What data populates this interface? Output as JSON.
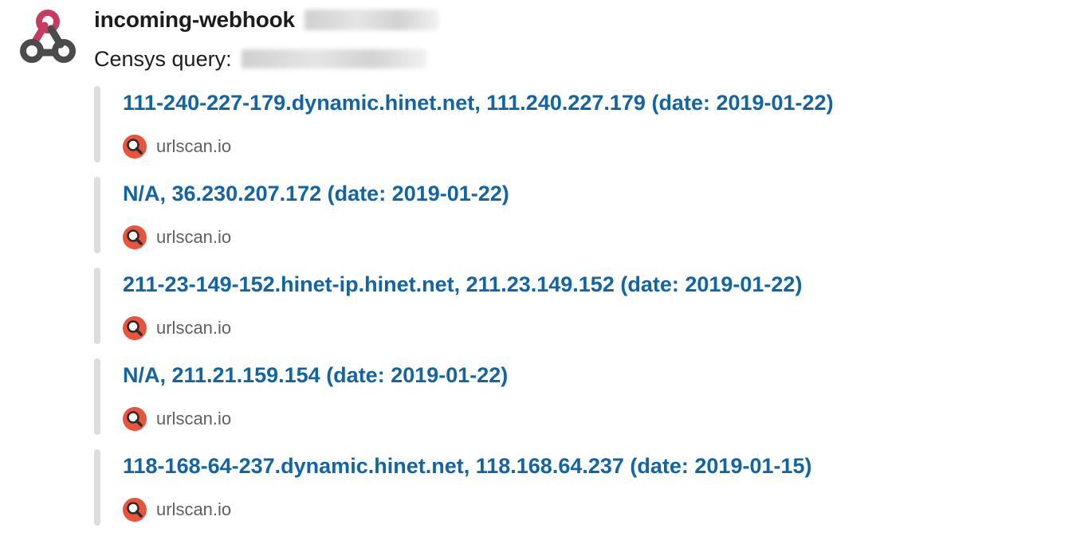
{
  "message": {
    "app_name": "incoming-webhook",
    "app_avatar_icon": "webhook-logo-icon",
    "text_label": "Censys query:"
  },
  "attachments": [
    {
      "title": "111-240-227-179.dynamic.hinet.net, 111.240.227.179 (date: 2019-01-22)",
      "footer": "urlscan.io",
      "footer_icon": "urlscan-icon"
    },
    {
      "title": "N/A, 36.230.207.172 (date: 2019-01-22)",
      "footer": "urlscan.io",
      "footer_icon": "urlscan-icon"
    },
    {
      "title": "211-23-149-152.hinet-ip.hinet.net, 211.23.149.152 (date: 2019-01-22)",
      "footer": "urlscan.io",
      "footer_icon": "urlscan-icon"
    },
    {
      "title": "N/A, 211.21.159.154 (date: 2019-01-22)",
      "footer": "urlscan.io",
      "footer_icon": "urlscan-icon"
    },
    {
      "title": "118-168-64-237.dynamic.hinet.net, 118.168.64.237 (date: 2019-01-15)",
      "footer": "urlscan.io",
      "footer_icon": "urlscan-icon"
    }
  ],
  "colors": {
    "link": "#1264a3",
    "attachment_bar": "#dddddd",
    "footer_text": "#616061",
    "webhook_pink": "#c73a63",
    "webhook_dark": "#4b4b4b",
    "urlscan_orange": "#e8553c"
  }
}
